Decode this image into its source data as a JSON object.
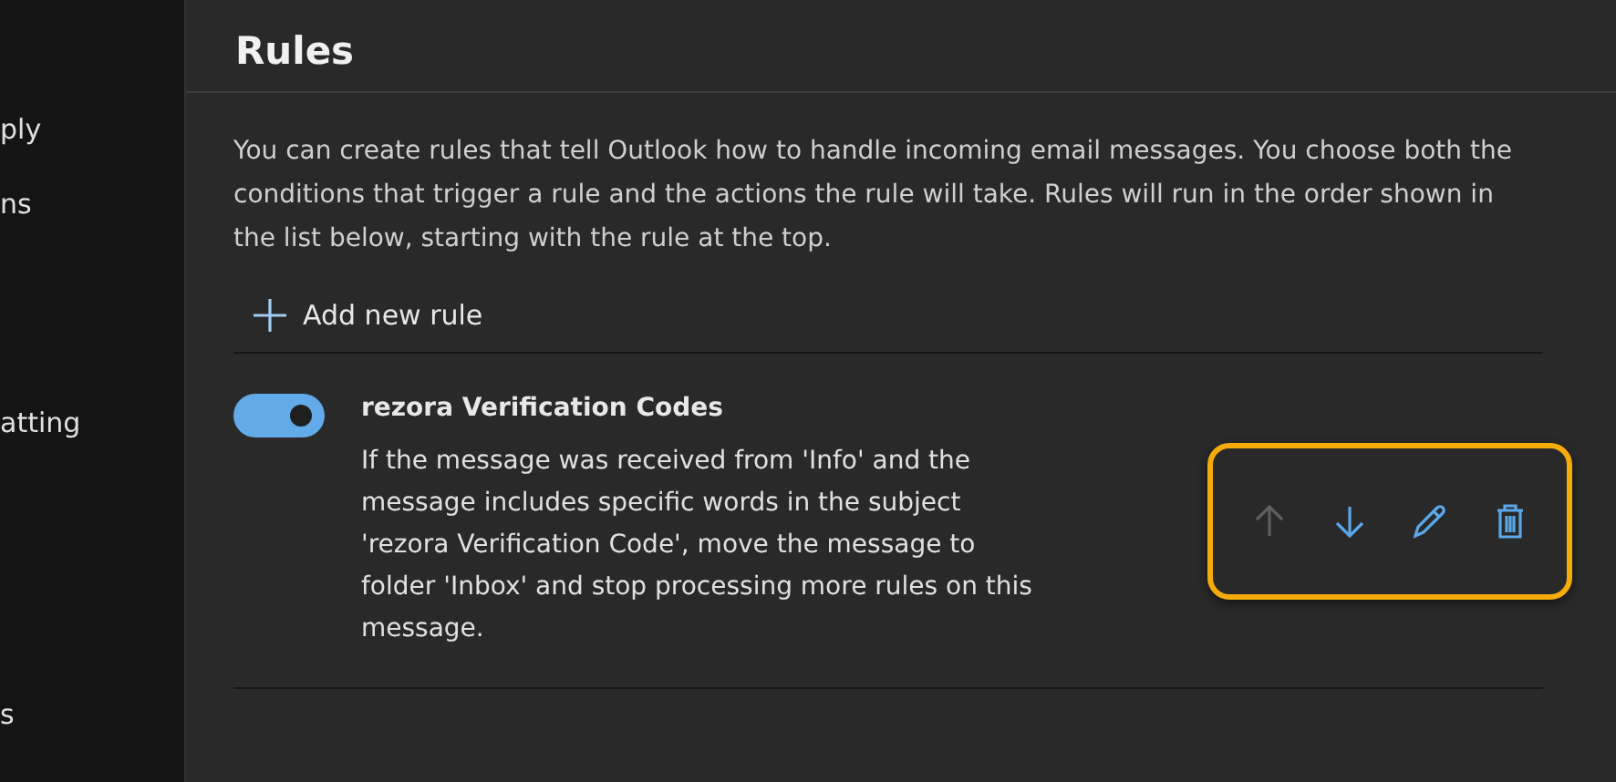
{
  "sidebar": {
    "items": [
      {
        "label": "ply"
      },
      {
        "label": "ns"
      },
      {
        "label": "atting"
      },
      {
        "label": "s"
      }
    ]
  },
  "title": "Rules",
  "description": "You can create rules that tell Outlook how to handle incoming email messages. You choose both the conditions that trigger a rule and the actions the rule will take. Rules will run in the order shown in the list below, starting with the rule at the top.",
  "add_button": {
    "label": "Add new rule"
  },
  "rules": [
    {
      "name": "rezora Verification Codes",
      "on": true,
      "description": "If the message was received from 'Info' and the message includes specific words in the subject 'rezora Verification Code', move the message to folder 'Inbox' and stop processing more rules on this message.",
      "highlighted": true,
      "actions": [
        {
          "kind": "up",
          "disabled": true
        },
        {
          "kind": "down",
          "disabled": false
        },
        {
          "kind": "edit",
          "disabled": false
        },
        {
          "kind": "delete",
          "disabled": false
        }
      ]
    }
  ]
}
